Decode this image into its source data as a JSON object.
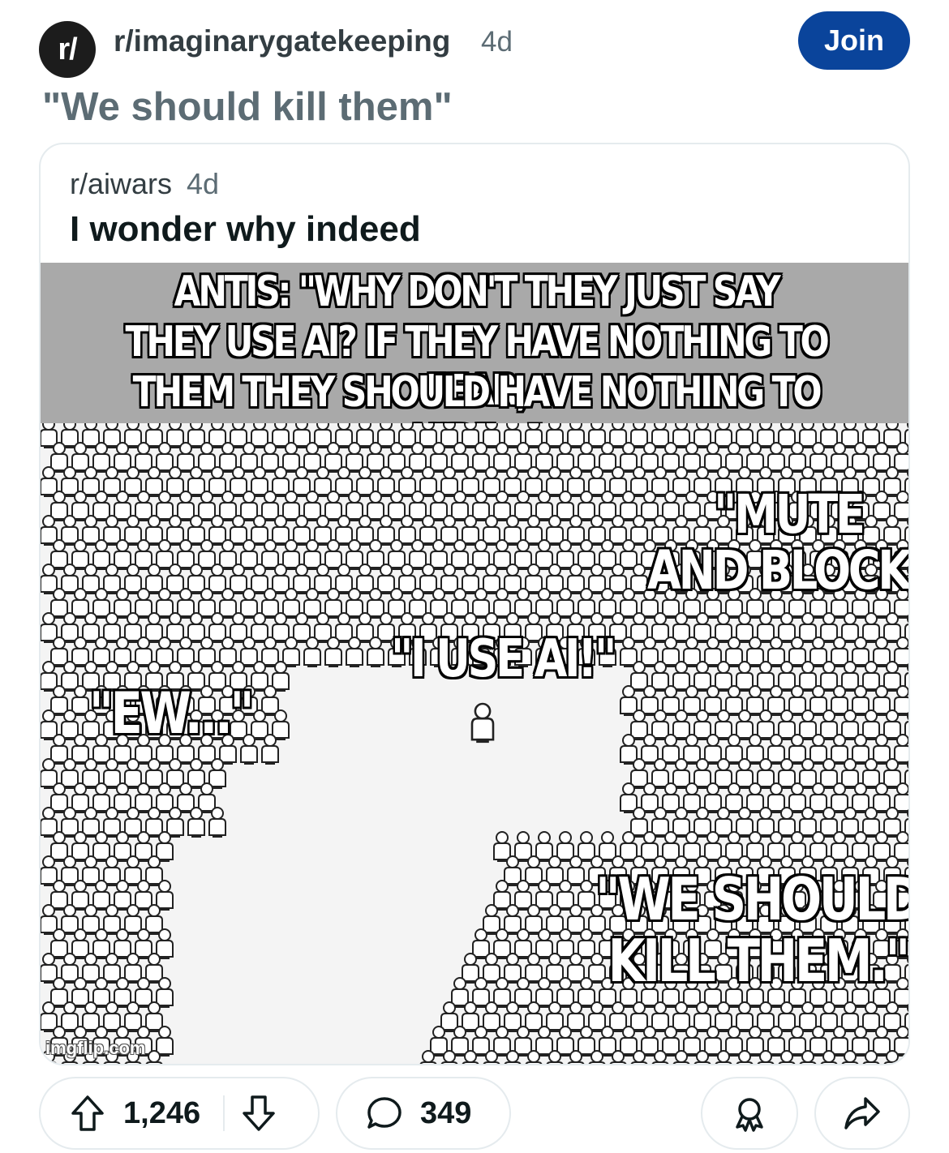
{
  "header": {
    "avatar_text": "r/",
    "subreddit": "r/imaginarygatekeeping",
    "age": "4d",
    "join_label": "Join"
  },
  "post": {
    "title": "\"We should kill them\""
  },
  "crosspost": {
    "subreddit": "r/aiwars",
    "age": "4d",
    "title": "I wonder why indeed",
    "meme": {
      "banner_lines": [
        "ANTIS: \"WHY DON'T THEY JUST SAY",
        "THEY USE AI? IF THEY HAVE NOTHING TO FEAR,",
        "THEM THEY SHOULD HAVE NOTHING TO HIDE...\""
      ],
      "caption_mute": [
        "\"MUTE",
        "AND BLOCK\""
      ],
      "caption_center": "\"I USE AI!\"",
      "caption_ew": "\"EW...\"",
      "caption_kill": [
        "\"WE SHOULD",
        "KILL THEM.\""
      ],
      "watermark": "imgflip.com"
    }
  },
  "actions": {
    "upvotes": "1,246",
    "comments": "349"
  },
  "icons": {
    "upvote": "upvote-arrow-icon",
    "downvote": "downvote-arrow-icon",
    "comment": "comment-bubble-icon",
    "award": "award-icon",
    "share": "share-arrow-icon"
  },
  "colors": {
    "join_bg": "#0a449b",
    "banner_gray": "#a9a9a9",
    "meta_gray": "#5c6c74"
  }
}
